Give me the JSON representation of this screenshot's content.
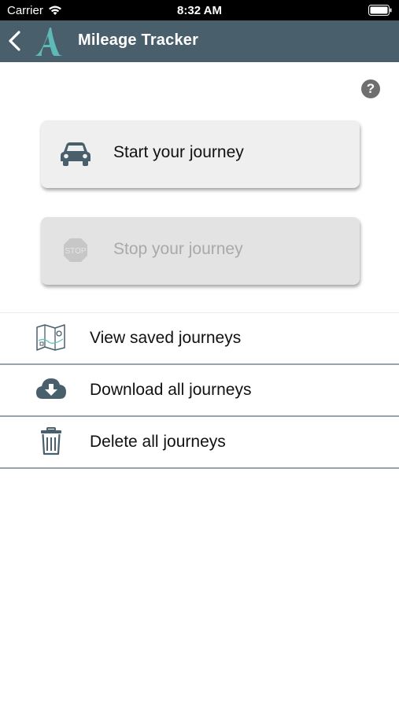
{
  "status_bar": {
    "carrier": "Carrier",
    "time": "8:32 AM"
  },
  "nav": {
    "title": "Mileage Tracker"
  },
  "help": {
    "glyph": "?"
  },
  "start_button": {
    "label": "Start your journey"
  },
  "stop_button": {
    "label": "Stop your journey",
    "icon_text": "STOP"
  },
  "list": [
    {
      "label": "View saved journeys",
      "icon": "map-icon"
    },
    {
      "label": "Download all journeys",
      "icon": "cloud-download-icon"
    },
    {
      "label": "Delete all journeys",
      "icon": "trash-icon"
    }
  ],
  "colors": {
    "nav_bg": "#4a5f6c",
    "icon_dark": "#4a5f6c",
    "logo_teal": "#5fc4c0",
    "disabled_text": "#a9a9a9"
  }
}
